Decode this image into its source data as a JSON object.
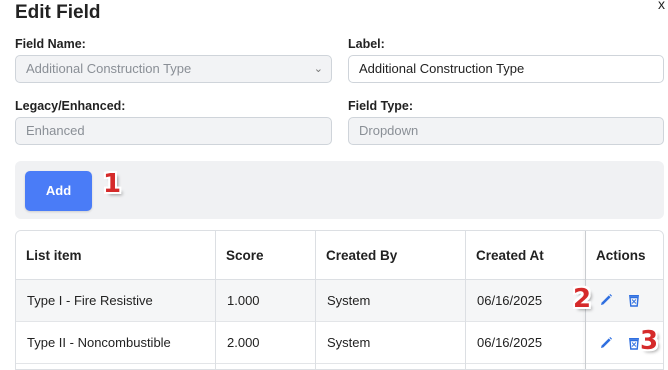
{
  "dialog": {
    "title": "Edit Field",
    "close_label": "x"
  },
  "form": {
    "field_name_label": "Field Name:",
    "field_name_value": "Additional Construction Type",
    "label_label": "Label:",
    "label_value": "Additional Construction Type",
    "legacy_label": "Legacy/Enhanced:",
    "legacy_value": "Enhanced",
    "field_type_label": "Field Type:",
    "field_type_value": "Dropdown"
  },
  "add_button_label": "Add",
  "callouts": [
    "1",
    "2",
    "3"
  ],
  "table": {
    "headers": [
      "List item",
      "Score",
      "Created By",
      "Created At",
      "Actions"
    ],
    "rows": [
      {
        "item": "Type I - Fire Resistive",
        "score": "1.000",
        "created_by": "System",
        "created_at": "06/16/2025"
      },
      {
        "item": "Type II - Noncombustible",
        "score": "2.000",
        "created_by": "System",
        "created_at": "06/16/2025"
      }
    ]
  },
  "colors": {
    "primary": "#4a7cf7",
    "callout": "#d52a2a",
    "edit_icon": "#2f6fe0",
    "delete_icon": "#2f6fe0"
  },
  "icons": [
    "pencil-icon",
    "trash-icon",
    "chevron-down-icon"
  ]
}
